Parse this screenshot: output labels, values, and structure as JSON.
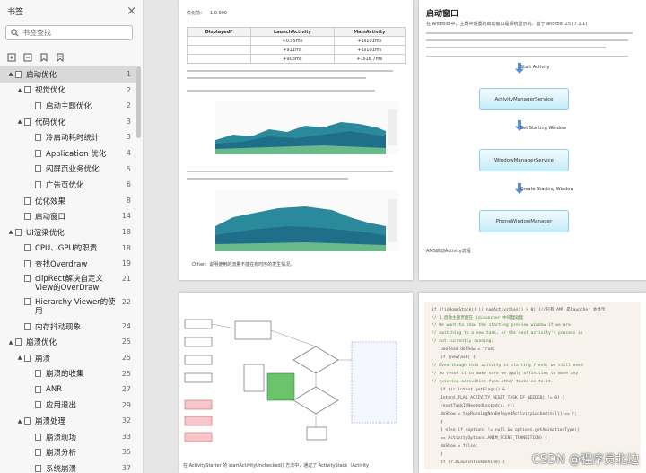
{
  "sidebar": {
    "title": "书签",
    "search_placeholder": "书签查找",
    "items": [
      {
        "label": "启动优化",
        "page": "1",
        "level": 0,
        "caret": "▲",
        "selected": true
      },
      {
        "label": "视觉优化",
        "page": "2",
        "level": 1,
        "caret": "▲"
      },
      {
        "label": "启动主题优化",
        "page": "2",
        "level": 2,
        "caret": ""
      },
      {
        "label": "代码优化",
        "page": "3",
        "level": 1,
        "caret": "▲"
      },
      {
        "label": "冷启动耗时统计",
        "page": "3",
        "level": 2,
        "caret": ""
      },
      {
        "label": "Application 优化",
        "page": "4",
        "level": 2,
        "caret": ""
      },
      {
        "label": "闪屏页业务优化",
        "page": "5",
        "level": 2,
        "caret": ""
      },
      {
        "label": "广告页优化",
        "page": "6",
        "level": 2,
        "caret": ""
      },
      {
        "label": "优化效果",
        "page": "8",
        "level": 1,
        "caret": ""
      },
      {
        "label": "启动窗口",
        "page": "14",
        "level": 1,
        "caret": ""
      },
      {
        "label": "UI渲染优化",
        "page": "18",
        "level": 0,
        "caret": "▲"
      },
      {
        "label": "CPU、GPU的职责",
        "page": "18",
        "level": 1,
        "caret": ""
      },
      {
        "label": "查找Overdraw",
        "page": "19",
        "level": 1,
        "caret": ""
      },
      {
        "label": "clipRect解决自定义View的OverDraw",
        "page": "21",
        "level": 1,
        "caret": "",
        "tall": true
      },
      {
        "label": "Hierarchy Viewer的使用",
        "page": "22",
        "level": 1,
        "caret": "",
        "tall": true
      },
      {
        "label": "内存抖动现象",
        "page": "24",
        "level": 1,
        "caret": ""
      },
      {
        "label": "崩溃优化",
        "page": "25",
        "level": 0,
        "caret": "▲"
      },
      {
        "label": "崩溃",
        "page": "25",
        "level": 1,
        "caret": "▲"
      },
      {
        "label": "崩溃的收集",
        "page": "25",
        "level": 2,
        "caret": ""
      },
      {
        "label": "ANR",
        "page": "27",
        "level": 2,
        "caret": ""
      },
      {
        "label": "应用退出",
        "page": "29",
        "level": 2,
        "caret": ""
      },
      {
        "label": "崩溃处理",
        "page": "32",
        "level": 1,
        "caret": "▲"
      },
      {
        "label": "崩溃现场",
        "page": "33",
        "level": 2,
        "caret": ""
      },
      {
        "label": "崩溃分析",
        "page": "35",
        "level": 2,
        "caret": ""
      },
      {
        "label": "系统崩溃",
        "page": "37",
        "level": 2,
        "caret": ""
      }
    ]
  },
  "page1": {
    "opt_label": "优化前：",
    "opt_value": "1.0.900",
    "table": {
      "headers": [
        "DisplayedF",
        "LaunchActivity",
        "MainActivity"
      ],
      "rows": [
        [
          "",
          "+0.95ms",
          "+1s101ms"
        ],
        [
          "",
          "+911ms",
          "+1s101ms"
        ],
        [
          "",
          "+903ms",
          "+1s18.7ms"
        ]
      ]
    },
    "note_bottom": "Other：说明使用的流量不能在有时序的发生情况。"
  },
  "page2": {
    "heading": "启动窗口",
    "text_1": "在 Android 中，主题中设置的启动窗口是系统显示的。基于 android 25 (7.1.1)",
    "flow_top_label": "Start Activity",
    "boxes": [
      "ActivityManagerService",
      "WindowManagerService",
      "PhoneWindowManager"
    ],
    "flow_labels": [
      "Set Starting Window",
      "Create Starting Window"
    ],
    "caption": "AMS启动Activity流程"
  },
  "page3": {
    "caption": "在 ActivityStarter 的 startActivityUnchecked() 方法中，通过了 ActivityStack（Activity"
  },
  "page4": {
    "code_lines": [
      "if (!isHomeStack() || numActivities() > 0) {//只有 AMS 是Launcher 会显示",
      "// 1.启动主题页面在 isLauncher 中同理处理",
      "// We want to show the starting preview window if we are",
      "// switching to a new task, or the next activity's process is",
      "// not currently running.",
      "boolean doShow = true;",
      "if (newTask) {",
      "// Even though this activity is starting fresh, we still need",
      "// to reset it to make sure we apply affinities to move any",
      "// existing activities from other tasks in to it.",
      "if ((r.intent.getFlags() &",
      "Intent.FLAG_ACTIVITY_RESET_TASK_IF_NEEDED) != 0) {",
      "resetTaskIfNeededLocked(r, r);",
      "doShow = topRunningNonDelayedActivityLocked(null) == r;",
      "}",
      "} else if (options != null && options.getAnimationType()",
      "== ActivityOptions.ANIM_SCENE_TRANSITION) {",
      "doShow = false;",
      "}",
      "if (r.mLaunchTaskBehind) {"
    ]
  },
  "watermark": "CSDN @程序员北边"
}
